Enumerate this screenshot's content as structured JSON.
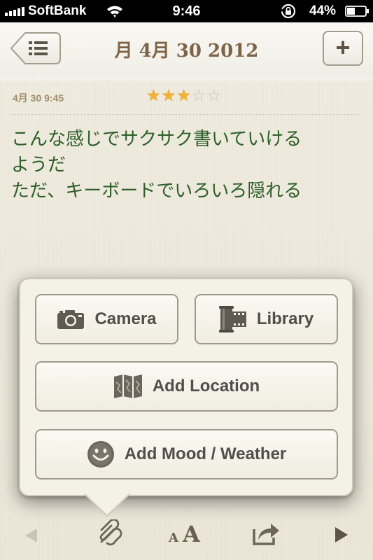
{
  "status_bar": {
    "carrier": "SoftBank",
    "time": "9:46",
    "battery_percent": "44%",
    "battery_level": 0.44,
    "signal_bars": 5,
    "icons": [
      "signal-icon",
      "wifi-icon",
      "rotation-lock-icon",
      "battery-icon"
    ]
  },
  "nav": {
    "title": "月 4月 30 2012",
    "add_label": "+",
    "icons": [
      "list-icon"
    ]
  },
  "entry": {
    "timestamp": "4月 30 9:45",
    "rating": 3,
    "rating_max": 5,
    "stars": [
      "★",
      "★",
      "★",
      "☆",
      "☆"
    ],
    "lines": [
      "こんな感じでサクサク書いていける",
      "ようだ",
      "ただ、キーボードでいろいろ隠れる"
    ],
    "text_color": "#2d5f27"
  },
  "popover": {
    "camera_label": "Camera",
    "library_label": "Library",
    "location_label": "Add Location",
    "mood_label": "Add Mood / Weather",
    "icons": [
      "camera-icon",
      "film-canister-icon",
      "map-icon",
      "smiley-icon"
    ]
  },
  "toolbar": {
    "font_small": "A",
    "font_big": "A",
    "icons": [
      "back-arrow-icon",
      "paperclip-icon",
      "font-size-icon",
      "share-icon",
      "forward-arrow-icon"
    ]
  }
}
